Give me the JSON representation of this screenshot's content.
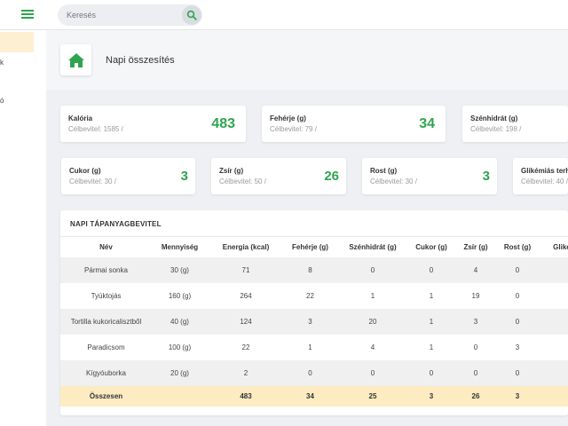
{
  "search": {
    "placeholder": "Keresés"
  },
  "sidebar": {
    "fragments": [
      "k",
      "ó"
    ]
  },
  "header": {
    "title": "Napi összesítés"
  },
  "colors": {
    "accent": "#2ea44f",
    "highlight": "#fdebc2"
  },
  "stats": [
    {
      "label": "Kalória",
      "goal": "Célbevitel: 1585 /",
      "value": "483"
    },
    {
      "label": "Fehérje (g)",
      "goal": "Célbevitel: 79 /",
      "value": "34"
    },
    {
      "label": "Szénhidrát (g)",
      "goal": "Célbevitel: 198 /",
      "value": ""
    },
    {
      "label": "Cukor (g)",
      "goal": "Célbevitel: 30 /",
      "value": "3"
    },
    {
      "label": "Zsír (g)",
      "goal": "Célbevitel: 50 /",
      "value": "26"
    },
    {
      "label": "Rost (g)",
      "goal": "Célbevitel: 30 /",
      "value": "3"
    },
    {
      "label": "Glikémiás terh",
      "goal": "Célbevitel: 40 /",
      "value": ""
    }
  ],
  "table": {
    "title": "NAPI TÁPANYAGBEVITEL",
    "columns": [
      "Név",
      "Mennyiség",
      "Energia (kcal)",
      "Fehérje (g)",
      "Szénhidrát (g)",
      "Cukor (g)",
      "Zsír (g)",
      "Rost (g)",
      "Glikém"
    ],
    "rows": [
      [
        "Pármai sonka",
        "30 (g)",
        "71",
        "8",
        "0",
        "0",
        "4",
        "0",
        ""
      ],
      [
        "Tyúktojás",
        "160 (g)",
        "264",
        "22",
        "1",
        "1",
        "19",
        "0",
        ""
      ],
      [
        "Tortilla kukoricalisztből",
        "40 (g)",
        "124",
        "3",
        "20",
        "1",
        "3",
        "0",
        ""
      ],
      [
        "Paradicsom",
        "100 (g)",
        "22",
        "1",
        "4",
        "1",
        "0",
        "3",
        ""
      ],
      [
        "Kígyóuborka",
        "20 (g)",
        "2",
        "0",
        "0",
        "0",
        "0",
        "0",
        ""
      ]
    ],
    "total": [
      "Összesen",
      "",
      "483",
      "34",
      "25",
      "3",
      "26",
      "3",
      ""
    ]
  }
}
